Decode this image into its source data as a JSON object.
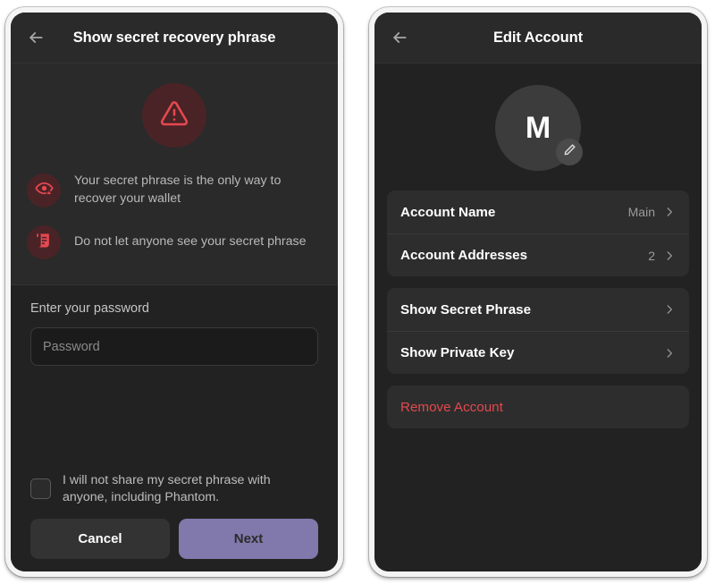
{
  "left_screen": {
    "header": {
      "back_icon": "arrow-left-icon",
      "title": "Show secret recovery phrase"
    },
    "warning": {
      "main_icon": "warning-triangle-icon",
      "items": [
        {
          "icon": "eye-warning-icon",
          "text": "Your secret phrase is the only way to recover your wallet"
        },
        {
          "icon": "scroll-document-icon",
          "text": "Do not let anyone see your secret phrase"
        }
      ]
    },
    "password": {
      "label": "Enter your password",
      "placeholder": "Password",
      "value": ""
    },
    "consent": {
      "checked": false,
      "text": "I will not share my secret phrase with anyone, including Phantom."
    },
    "buttons": {
      "cancel_label": "Cancel",
      "next_label": "Next"
    }
  },
  "right_screen": {
    "header": {
      "back_icon": "arrow-left-icon",
      "title": "Edit Account"
    },
    "avatar": {
      "initial": "M",
      "edit_icon": "pencil-icon"
    },
    "group_one": [
      {
        "label": "Account Name",
        "value": "Main",
        "chevron": "chevron-right-icon"
      },
      {
        "label": "Account Addresses",
        "value": "2",
        "chevron": "chevron-right-icon"
      }
    ],
    "group_two": [
      {
        "label": "Show Secret Phrase",
        "value": "",
        "chevron": "chevron-right-icon"
      },
      {
        "label": "Show Private Key",
        "value": "",
        "chevron": "chevron-right-icon"
      }
    ],
    "group_three": [
      {
        "label": "Remove Account",
        "value": "",
        "chevron": ""
      }
    ]
  },
  "colors": {
    "accent_purple": "#8179ab",
    "danger_red": "#e5484d",
    "warning_red": "#e8484f",
    "screen_bg": "#222222",
    "header_bg": "#2a2a2a",
    "card_bg": "#2d2d2d"
  }
}
